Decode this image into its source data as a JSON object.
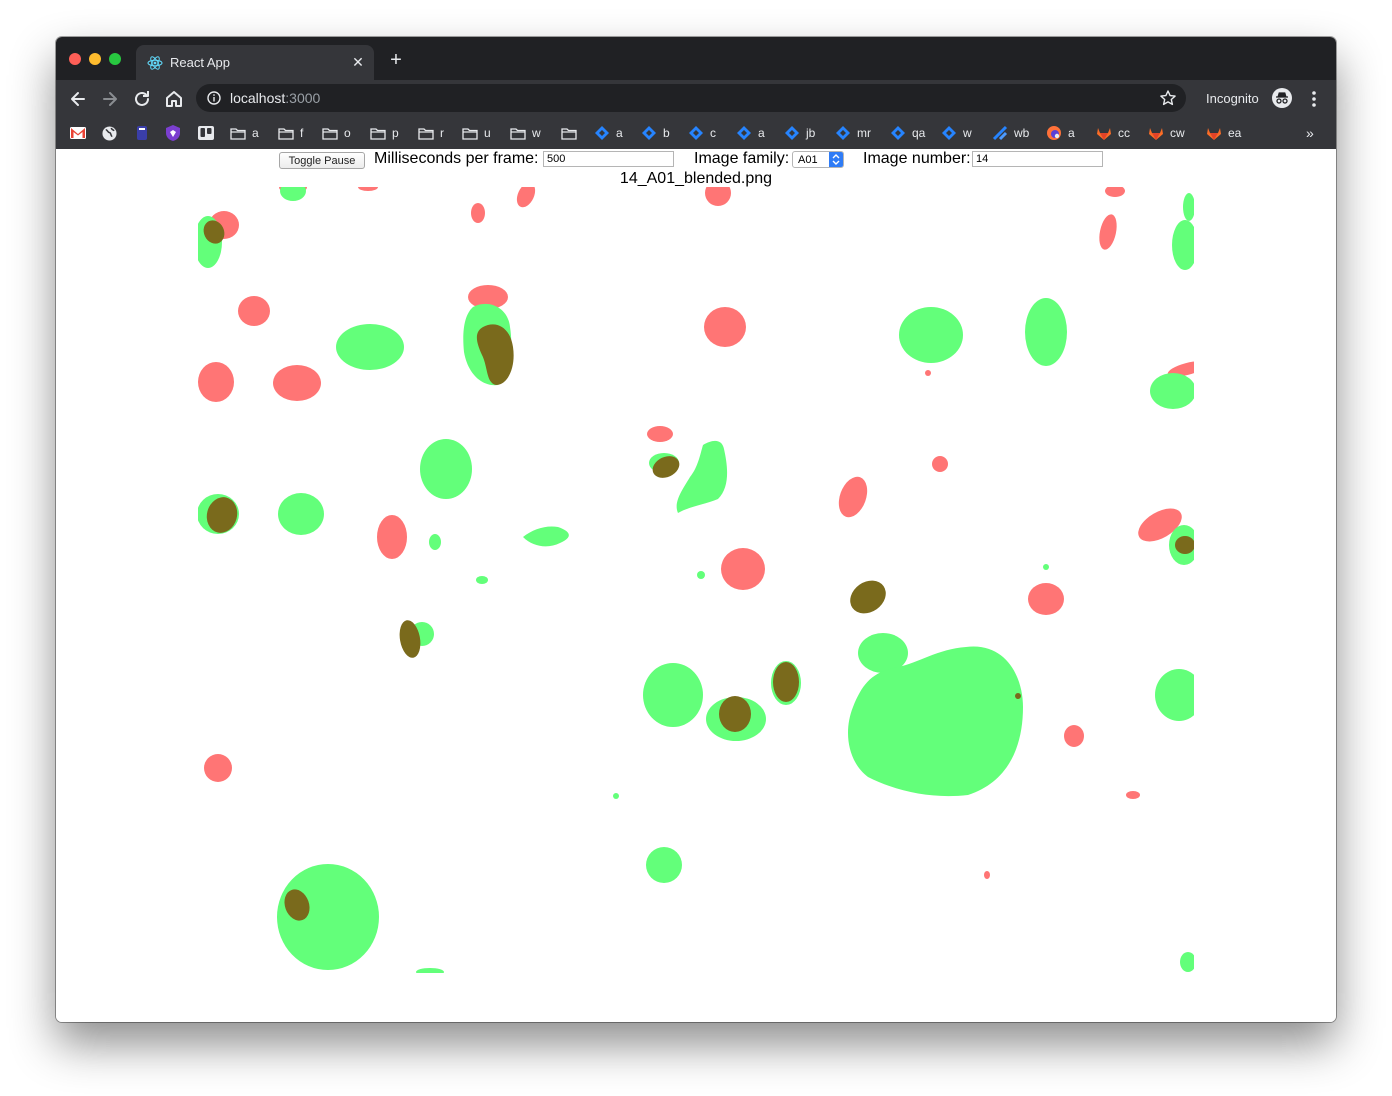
{
  "browser": {
    "tab_title": "React App",
    "url_host": "localhost",
    "url_port": ":3000",
    "incognito_label": "Incognito",
    "bookmarks": [
      {
        "label": "a",
        "icon": "folder-icon"
      },
      {
        "label": "f",
        "icon": "folder-icon"
      },
      {
        "label": "o",
        "icon": "folder-icon"
      },
      {
        "label": "p",
        "icon": "folder-icon"
      },
      {
        "label": "r",
        "icon": "folder-icon"
      },
      {
        "label": "u",
        "icon": "folder-icon"
      },
      {
        "label": "w",
        "icon": "folder-icon"
      },
      {
        "label": "",
        "icon": "folder-icon"
      },
      {
        "label": "a",
        "icon": "jira-icon"
      },
      {
        "label": "b",
        "icon": "jira-icon"
      },
      {
        "label": "c",
        "icon": "jira-icon"
      },
      {
        "label": "a",
        "icon": "jira-icon"
      },
      {
        "label": "jb",
        "icon": "jira-icon"
      },
      {
        "label": "mr",
        "icon": "jira-icon"
      },
      {
        "label": "qa",
        "icon": "jira-icon"
      },
      {
        "label": "w",
        "icon": "jira-icon"
      },
      {
        "label": "wb",
        "icon": "jira-software-icon"
      },
      {
        "label": "a",
        "icon": "firefox-icon"
      },
      {
        "label": "cc",
        "icon": "gitlab-icon"
      },
      {
        "label": "cw",
        "icon": "gitlab-icon"
      },
      {
        "label": "ea",
        "icon": "gitlab-icon"
      }
    ],
    "overflow_label": "»"
  },
  "app": {
    "toggle_pause_label": "Toggle Pause",
    "ms_per_frame_label": "Milliseconds per frame:",
    "ms_per_frame_value": "500",
    "image_family_label": "Image family:",
    "image_family_value": "A01",
    "image_number_label": "Image number:",
    "image_number_value": "14",
    "filename": "14_A01_blended.png"
  },
  "colors": {
    "red_mask": "#ff7575",
    "green_mask": "#63ff7a",
    "overlap": "#7a6a1c"
  }
}
